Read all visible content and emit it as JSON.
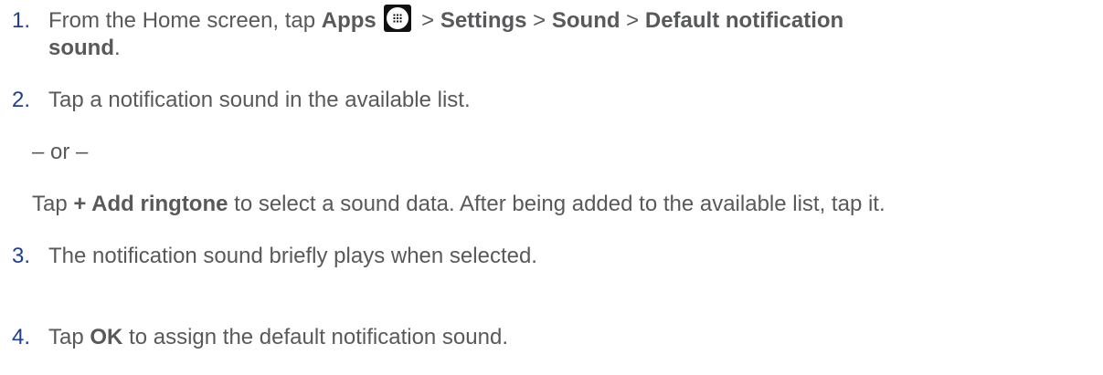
{
  "steps": [
    {
      "number": "1.",
      "parts": {
        "a": "From the Home screen, tap ",
        "apps": "Apps",
        "sep1": " > ",
        "settings": "Settings",
        "sep2": " > ",
        "sound": "Sound",
        "sep3": " > ",
        "default": "Default notification",
        "cont": "sound",
        "end": "."
      },
      "icon": "apps-icon"
    },
    {
      "number": "2.",
      "text": "Tap a notification sound in the available list."
    },
    {
      "number": "3.",
      "text": "The notification sound briefly plays when selected."
    },
    {
      "number": "4.",
      "parts": {
        "a": "Tap ",
        "ok": "OK",
        "b": " to assign the default notification sound."
      }
    }
  ],
  "alternative": {
    "separator": "– or –",
    "a": "Tap ",
    "bold": "+ Add ringtone",
    "b": " to select a sound data. After being added to the available list, tap it."
  },
  "colors": {
    "step_number": "#1f3f8f",
    "body_text": "#58595b"
  }
}
